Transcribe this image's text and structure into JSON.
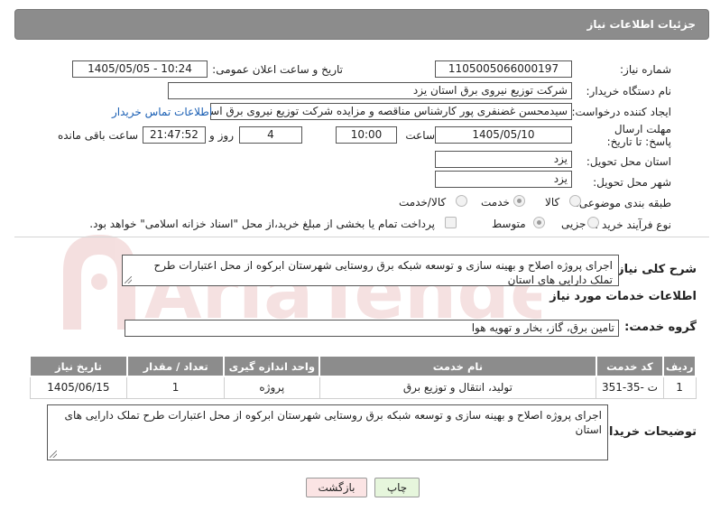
{
  "header": {
    "title": "جزئیات اطلاعات نیاز"
  },
  "form": {
    "need_number_label": "شماره نیاز:",
    "need_number": "1105005066000197",
    "announce_label": "تاریخ و ساعت اعلان عمومی:",
    "announce_value": "1405/05/05 - 10:24",
    "buyer_org_label": "نام دستگاه خریدار:",
    "buyer_org": "شرکت توزیع نیروی برق استان یزد",
    "creator_label": "ایجاد کننده درخواست:",
    "creator": "سیدمحسن غضنفری پور کارشناس مناقصه و مزایده شرکت توزیع نیروی برق استا",
    "contact_link": "اطلاعات تماس خریدار",
    "deadline_label": "مهلت ارسال پاسخ: تا تاریخ:",
    "deadline_date": "1405/05/10",
    "time_label": "ساعت",
    "deadline_time": "10:00",
    "days_value": "4",
    "days_label": "روز و",
    "remaining_time": "21:47:52",
    "remaining_label": "ساعت باقی مانده",
    "province_label": "استان محل تحویل:",
    "province": "یزد",
    "city_label": "شهر محل تحویل:",
    "city": "یزد",
    "category_label": "طبقه بندی موضوعی:",
    "category_options": [
      "کالا",
      "خدمت",
      "کالا/خدمت"
    ],
    "category_selected": "خدمت",
    "process_label": "نوع فرآیند خرید :",
    "process_options": [
      "جزیی",
      "متوسط"
    ],
    "process_selected": "متوسط",
    "payment_note": "پرداخت تمام یا بخشی از مبلغ خرید،از محل \"اسناد خزانه اسلامی\" خواهد بود."
  },
  "summary": {
    "label": "شرح کلی نیاز:",
    "text": "اجرای پروژه اصلاح و بهینه سازی و توسعه شبکه برق روستایی شهرستان ابرکوه از محل اعتبارات طرح تملک دارایی های استان"
  },
  "services": {
    "section_title": "اطلاعات خدمات مورد نیاز",
    "group_label": "گروه خدمت:",
    "group_value": "تامین برق، گاز، بخار و تهویه هوا",
    "columns": [
      "ردیف",
      "کد خدمت",
      "نام خدمت",
      "واحد اندازه گیری",
      "تعداد / مقدار",
      "تاریخ نیاز"
    ],
    "rows": [
      {
        "row": "1",
        "code": "ت -35-351",
        "name": "تولید، انتقال و توزیع برق",
        "unit": "پروژه",
        "qty": "1",
        "date": "1405/06/15"
      }
    ]
  },
  "buyer_notes": {
    "label": "توضیحات خریدار:",
    "text": "اجرای پروژه اصلاح و بهینه سازی و توسعه شبکه برق روستایی شهرستان ابرکوه از محل اعتبارات طرح تملک دارایی های استان"
  },
  "buttons": {
    "print": "چاپ",
    "back": "بازگشت"
  },
  "watermark": {
    "text": "AriaTender.net"
  },
  "colors": {
    "header_bg": "#8c8c8c",
    "link": "#1a5fb4",
    "print_bg": "#e6f6dc",
    "back_bg": "#fbe4e4"
  }
}
